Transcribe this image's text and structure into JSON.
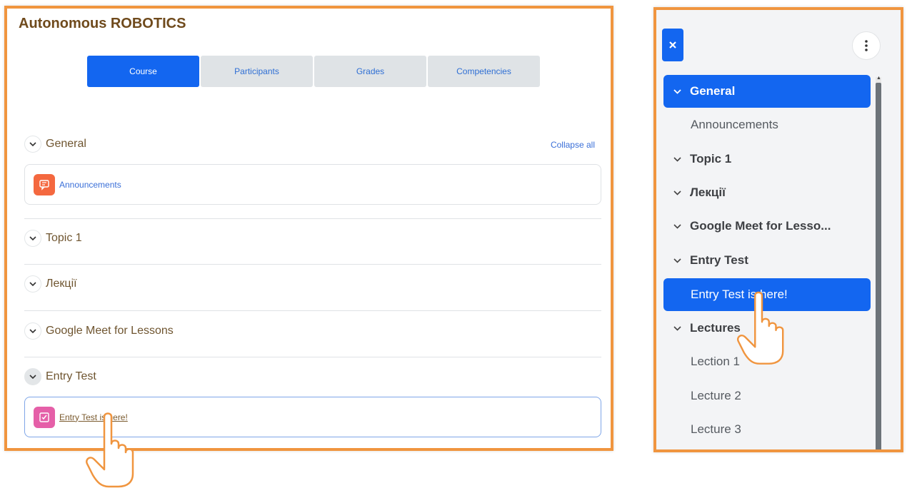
{
  "course": {
    "title": "Autonomous ROBOTICS",
    "tabs": [
      {
        "label": "Course",
        "active": true
      },
      {
        "label": "Participants",
        "active": false
      },
      {
        "label": "Grades",
        "active": false
      },
      {
        "label": "Competencies",
        "active": false
      }
    ],
    "collapse_all": "Collapse all",
    "sections": [
      {
        "title": "General",
        "activity": "Announcements",
        "activity_icon": "forum-icon"
      },
      {
        "title": "Topic 1"
      },
      {
        "title": "Лекції"
      },
      {
        "title": "Google Meet for Lessons"
      },
      {
        "title": "Entry Test",
        "activity": "Entry Test is here!",
        "activity_icon": "quiz-icon"
      }
    ]
  },
  "course_index": {
    "close_icon": "close-icon",
    "menu_icon": "kebab-menu-icon",
    "items": [
      {
        "label": "General",
        "type": "section",
        "active": true
      },
      {
        "label": "Announcements",
        "type": "activity"
      },
      {
        "label": "Topic 1",
        "type": "section"
      },
      {
        "label": "Лекції",
        "type": "section"
      },
      {
        "label": "Google Meet for Lesso...",
        "type": "section"
      },
      {
        "label": "Entry Test",
        "type": "section"
      },
      {
        "label": "Entry Test is here!",
        "type": "activity",
        "active": true
      },
      {
        "label": "Lectures",
        "type": "section"
      },
      {
        "label": "Lection 1",
        "type": "activity"
      },
      {
        "label": "Lecture 2",
        "type": "activity"
      },
      {
        "label": "Lecture 3",
        "type": "activity"
      }
    ]
  },
  "colors": {
    "accent": "#1366f0",
    "frame": "#f0953f",
    "title_brown": "#6f4a1c"
  }
}
